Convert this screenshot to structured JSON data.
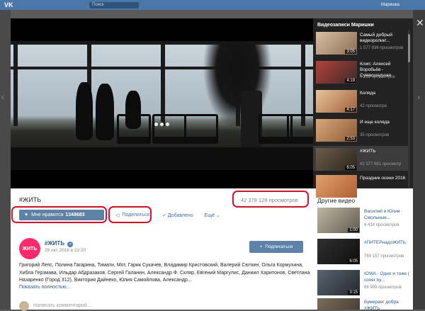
{
  "app": {
    "logo": "VK",
    "search_placeholder": "Поиск",
    "user": "Маришка"
  },
  "sidebar": {
    "title": "Видеозаписи Маришки",
    "items": [
      {
        "title": "Самый добрый видеоролик!...",
        "views": "1 577 836 просмотров",
        "duration": "3:05"
      },
      {
        "title": "Клип: Алексей Воробьёв - Сумасшедшая",
        "views": "4 259 просмотров",
        "duration": "4:19"
      },
      {
        "title": "Коляда",
        "views": "42 просмотра",
        "duration": "4:17"
      },
      {
        "title": "И еще коляда",
        "views": "35 просмотров",
        "duration": "2:53"
      },
      {
        "title": "#ЖИТЬ",
        "views": "42 377 681 просмотр",
        "duration": "6:05"
      },
      {
        "title": "Праздник осени 2016",
        "views": "",
        "duration": ""
      }
    ]
  },
  "video": {
    "title": "#ЖИТЬ",
    "views": "42 378 129 просмотров",
    "like_label": "Мне нравится",
    "like_count": "1348683",
    "share_label": "Поделиться",
    "added_label": "Добавлено",
    "more_label": "Ещё"
  },
  "author": {
    "avatar_text": "ЖИТЬ",
    "name": "#ЖИТЬ",
    "date": "28 окт 2016 в 22:20",
    "subscribe_label": "Подписаться"
  },
  "description": "Григорий Лепс, Полина Гагарина, Тимати, Мот, Гарик Сукачев, Владимир Кристовский, Валерий Сюткин, Ольга Кормухина, Хибла Герзмава, Ильдар Абдразаков, Сергей Галанин, Александр Ф. Скляр, Евгений Маргулис, Даниил Харитонов, Светлана Назаренко (Город 312), Виктория Дайнеко, Юлия Самойлова, Александр...",
  "show_more": "Показать полностью...",
  "comment_placeholder": "Написать комментарий...",
  "other": {
    "title": "Другие видео",
    "items": [
      {
        "title": "Василий и Юлия Смольные...",
        "views": "4 414 просмотров",
        "duration": "1:00"
      },
      {
        "title": "#ПИТЕРнадоЖИТЬ",
        "views": "769 157 просмотров",
        "duration": "6:05"
      },
      {
        "title": "IOWA - Одно и тоже ( cover by...",
        "views": "66 999 просмотров",
        "duration": "3:15"
      },
      {
        "title": "Бумеранг добра #ЖИТЬ",
        "views": "",
        "duration": ""
      }
    ]
  },
  "colors": {
    "accent": "#5e81a8",
    "link": "#2a5885",
    "highlight": "#d5102a"
  }
}
